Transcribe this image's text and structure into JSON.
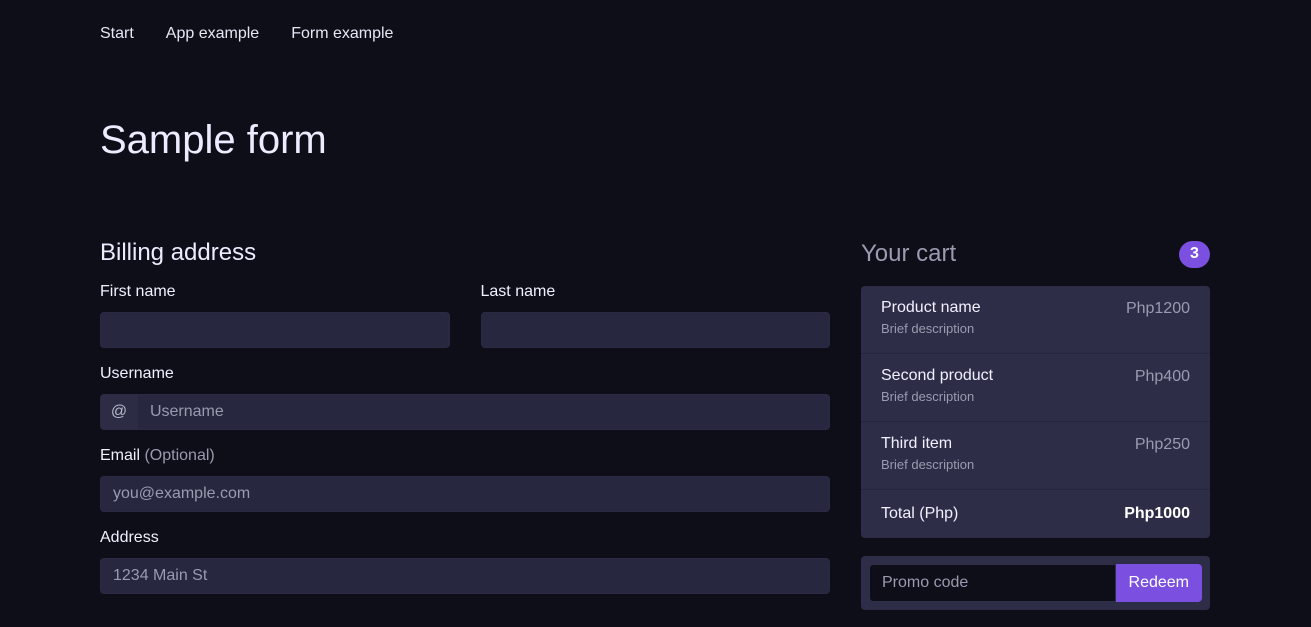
{
  "nav": {
    "items": [
      "Start",
      "App example",
      "Form example"
    ]
  },
  "page_title": "Sample form",
  "billing": {
    "title": "Billing address",
    "first_name_label": "First name",
    "last_name_label": "Last name",
    "username_label": "Username",
    "username_prefix": "@",
    "username_placeholder": "Username",
    "email_label": "Email",
    "email_optional": "(Optional)",
    "email_placeholder": "you@example.com",
    "address_label": "Address",
    "address_placeholder": "1234 Main St"
  },
  "cart": {
    "title": "Your cart",
    "count": "3",
    "items": [
      {
        "name": "Product name",
        "description": "Brief description",
        "price": "Php1200"
      },
      {
        "name": "Second product",
        "description": "Brief description",
        "price": "Php400"
      },
      {
        "name": "Third item",
        "description": "Brief description",
        "price": "Php250"
      }
    ],
    "total_label": "Total (Php)",
    "total_value": "Php1000",
    "promo_placeholder": "Promo code",
    "redeem_label": "Redeem"
  },
  "colors": {
    "background": "#0e0e19",
    "accent": "#7b4fe0",
    "input_bg": "#272740",
    "card_bg": "#2d2d47"
  }
}
